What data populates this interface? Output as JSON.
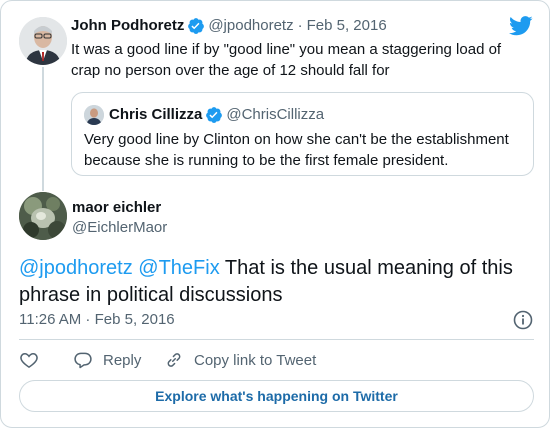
{
  "parent_tweet": {
    "author_name": "John Podhoretz",
    "author_handle": "@jpodhoretz",
    "separator": "·",
    "date": "Feb 5, 2016",
    "text": "It was a good line if by \"good line\" you mean a staggering load of crap no person over the age of 12 should fall for",
    "verified": true
  },
  "quoted_tweet": {
    "author_name": "Chris Cillizza",
    "author_handle": "@ChrisCillizza",
    "text": "Very good line by Clinton on how she can't be the establishment because she is running to be the first female president.",
    "verified": true
  },
  "main_tweet": {
    "author_name": "maor eichler",
    "author_handle": "@EichlerMaor",
    "mention_1": "@jpodhoretz",
    "mention_2": "@TheFix",
    "text": "That is the usual meaning of this phrase in political discussions",
    "timestamp": "11:26 AM · Feb 5, 2016"
  },
  "actions": {
    "like_icon": "heart-icon",
    "reply_label": "Reply",
    "copy_label": "Copy link to Tweet"
  },
  "explore_label": "Explore what's happening on Twitter",
  "colors": {
    "twitter_blue": "#1d9bf0",
    "explore_text": "#1d6ba8",
    "secondary_text": "#536471",
    "border": "#cfd9de"
  }
}
